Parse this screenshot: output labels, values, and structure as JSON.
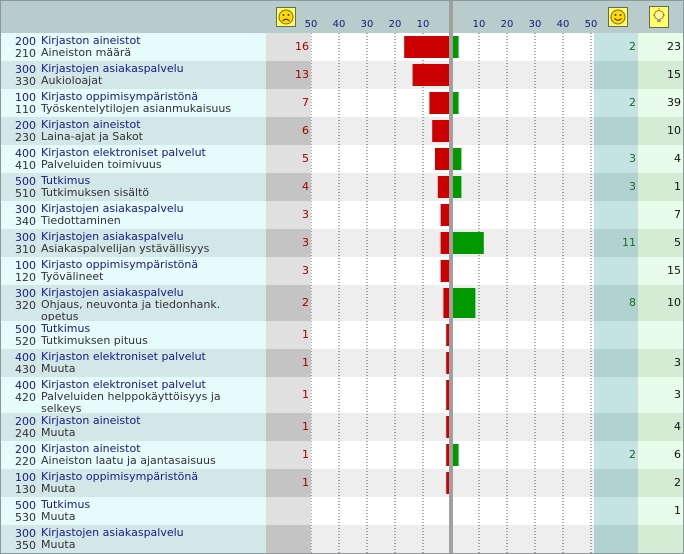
{
  "header": {
    "neg_ticks": [
      "50",
      "40",
      "30",
      "20",
      "10"
    ],
    "pos_ticks": [
      "10",
      "20",
      "30",
      "40",
      "50"
    ]
  },
  "colors": {
    "negative_bar": "#cc0000",
    "positive_bar": "#009900",
    "face": "#ffff66"
  },
  "icons": {
    "negative_header": "sad-face-icon",
    "positive_header": "happy-face-icon",
    "total_header": "lightbulb-icon"
  },
  "chart_data": {
    "type": "bar",
    "axis": {
      "neg_range": [
        0,
        50
      ],
      "pos_range": [
        0,
        50
      ]
    },
    "rows": [
      {
        "cat_code": "200",
        "cat": "Kirjaston aineistot",
        "sub_code": "210",
        "sub": "Aineiston määrä",
        "neg": 16,
        "pos": 2,
        "ideas": 23
      },
      {
        "cat_code": "300",
        "cat": "Kirjastojen asiakaspalvelu",
        "sub_code": "330",
        "sub": "Aukioloajat",
        "neg": 13,
        "pos": null,
        "ideas": 15
      },
      {
        "cat_code": "100",
        "cat": "Kirjasto oppimisympäristönä",
        "sub_code": "110",
        "sub": "Työskentelytilojen asianmukaisuus",
        "neg": 7,
        "pos": 2,
        "ideas": 39
      },
      {
        "cat_code": "200",
        "cat": "Kirjaston aineistot",
        "sub_code": "230",
        "sub": "Laina-ajat ja Sakot",
        "neg": 6,
        "pos": null,
        "ideas": 10
      },
      {
        "cat_code": "400",
        "cat": "Kirjaston elektroniset palvelut",
        "sub_code": "410",
        "sub": "Palveluiden toimivuus",
        "neg": 5,
        "pos": 3,
        "ideas": 4
      },
      {
        "cat_code": "500",
        "cat": "Tutkimus",
        "sub_code": "510",
        "sub": "Tutkimuksen sisältö",
        "neg": 4,
        "pos": 3,
        "ideas": 1
      },
      {
        "cat_code": "300",
        "cat": "Kirjastojen asiakaspalvelu",
        "sub_code": "340",
        "sub": "Tiedottaminen",
        "neg": 3,
        "pos": null,
        "ideas": 7
      },
      {
        "cat_code": "300",
        "cat": "Kirjastojen asiakaspalvelu",
        "sub_code": "310",
        "sub": "Asiakaspalvelijan ystävällisyys",
        "neg": 3,
        "pos": 11,
        "ideas": 5
      },
      {
        "cat_code": "100",
        "cat": "Kirjasto oppimisympäristönä",
        "sub_code": "120",
        "sub": "Työvälineet",
        "neg": 3,
        "pos": null,
        "ideas": 15
      },
      {
        "cat_code": "300",
        "cat": "Kirjastojen asiakaspalvelu",
        "sub_code": "320",
        "sub": "Ohjaus, neuvonta ja tiedonhank.",
        "sub2": "opetus",
        "neg": 2,
        "pos": 8,
        "ideas": 10
      },
      {
        "cat_code": "500",
        "cat": "Tutkimus",
        "sub_code": "520",
        "sub": "Tutkimuksen pituus",
        "neg": 1,
        "pos": null,
        "ideas": null
      },
      {
        "cat_code": "400",
        "cat": "Kirjaston elektroniset palvelut",
        "sub_code": "430",
        "sub": "Muuta",
        "neg": 1,
        "pos": null,
        "ideas": 3
      },
      {
        "cat_code": "400",
        "cat": "Kirjaston elektroniset palvelut",
        "sub_code": "420",
        "sub": "Palveluiden helppokäyttöisyys ja",
        "sub2": "selkeys",
        "neg": 1,
        "pos": null,
        "ideas": 3
      },
      {
        "cat_code": "200",
        "cat": "Kirjaston aineistot",
        "sub_code": "240",
        "sub": "Muuta",
        "neg": 1,
        "pos": null,
        "ideas": 4
      },
      {
        "cat_code": "200",
        "cat": "Kirjaston aineistot",
        "sub_code": "220",
        "sub": "Aineiston laatu ja ajantasaisuus",
        "neg": 1,
        "pos": 2,
        "ideas": 6
      },
      {
        "cat_code": "100",
        "cat": "Kirjasto oppimisympäristönä",
        "sub_code": "130",
        "sub": "Muuta",
        "neg": 1,
        "pos": null,
        "ideas": 2
      },
      {
        "cat_code": "500",
        "cat": "Tutkimus",
        "sub_code": "530",
        "sub": "Muuta",
        "neg": null,
        "pos": null,
        "ideas": 1
      },
      {
        "cat_code": "300",
        "cat": "Kirjastojen asiakaspalvelu",
        "sub_code": "350",
        "sub": "Muuta",
        "neg": null,
        "pos": null,
        "ideas": null
      }
    ]
  }
}
